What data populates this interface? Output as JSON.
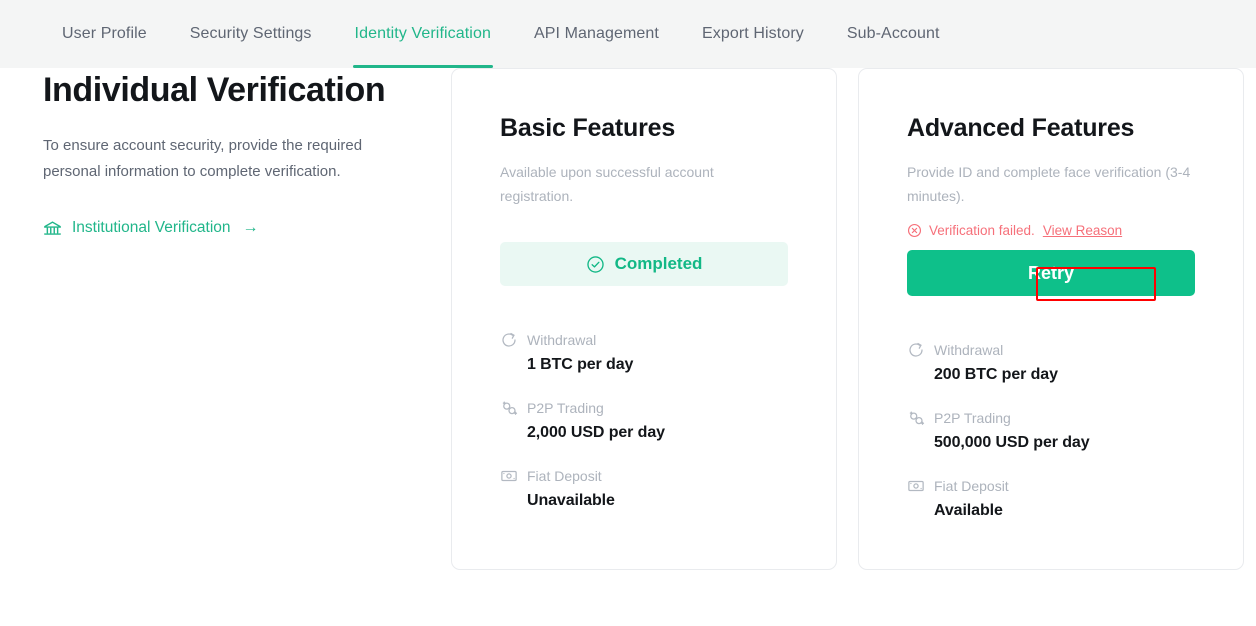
{
  "theme": {
    "accent_green": "#21b68a",
    "button_green": "#0ec08a",
    "completed_green": "#12b886",
    "completed_bg": "#eaf8f3",
    "error_red": "#f6707a",
    "annotation_red": "#ff0000",
    "muted_text": "#adb3bc",
    "tab_text": "#5f6673",
    "header_bg": "#f4f5f5"
  },
  "tabs": [
    {
      "label": "User Profile",
      "active": false
    },
    {
      "label": "Security Settings",
      "active": false
    },
    {
      "label": "Identity Verification",
      "active": true
    },
    {
      "label": "API Management",
      "active": false
    },
    {
      "label": "Export History",
      "active": false
    },
    {
      "label": "Sub-Account",
      "active": false
    }
  ],
  "intro": {
    "title": "Individual Verification",
    "description": "To ensure account security, provide the required personal information to complete verification.",
    "link_label": "Institutional Verification",
    "link_arrow": "→",
    "link_icon": "bank-icon"
  },
  "cards": [
    {
      "id": "basic",
      "title": "Basic Features",
      "description": "Available upon successful account registration.",
      "status": {
        "type": "completed",
        "icon": "check-circle-icon",
        "label": "Completed"
      },
      "features": [
        {
          "icon": "withdrawal-icon",
          "label": "Withdrawal",
          "value": "1 BTC per day"
        },
        {
          "icon": "p2p-trading-icon",
          "label": "P2P Trading",
          "value": "2,000 USD per day"
        },
        {
          "icon": "fiat-deposit-icon",
          "label": "Fiat Deposit",
          "value": "Unavailable"
        }
      ]
    },
    {
      "id": "advanced",
      "title": "Advanced Features",
      "description": "Provide ID and complete face verification (3-4 minutes).",
      "status": {
        "type": "failed",
        "icon": "error-circle-icon",
        "label": "Verification failed.",
        "link_label": "View Reason",
        "button_label": "Retry"
      },
      "features": [
        {
          "icon": "withdrawal-icon",
          "label": "Withdrawal",
          "value": "200 BTC per day"
        },
        {
          "icon": "p2p-trading-icon",
          "label": "P2P Trading",
          "value": "500,000 USD per day"
        },
        {
          "icon": "fiat-deposit-icon",
          "label": "Fiat Deposit",
          "value": "Available"
        }
      ]
    }
  ]
}
